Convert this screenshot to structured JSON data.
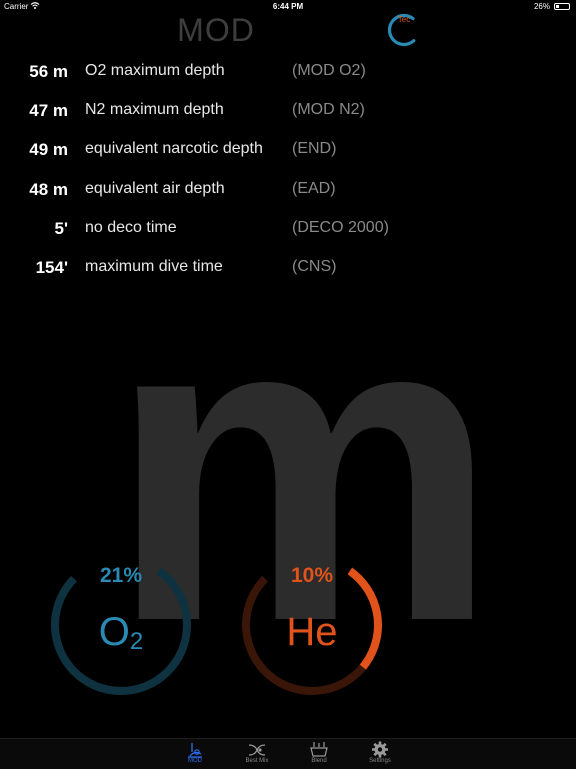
{
  "status_bar": {
    "carrier": "Carrier",
    "time": "6:44 PM",
    "battery": "26%",
    "battery_level": 0.26
  },
  "header": {
    "title": "MOD",
    "tec_label": "Tec",
    "tec_color": "#2a8ab3"
  },
  "rows": [
    {
      "value": "56 m",
      "label": "O2 maximum depth",
      "abbr": "(MOD O2)"
    },
    {
      "value": "47 m",
      "label": "N2 maximum depth",
      "abbr": "(MOD N2)"
    },
    {
      "value": "49 m",
      "label": "equivalent narcotic depth",
      "abbr": "(END)"
    },
    {
      "value": "48 m",
      "label": "equivalent air depth",
      "abbr": "(EAD)"
    },
    {
      "value": "5'",
      "label": "no deco time",
      "abbr": "(DECO 2000)"
    },
    {
      "value": "154'",
      "label": "maximum dive time",
      "abbr": "(CNS)"
    }
  ],
  "background_letter": "m",
  "gauges": {
    "o2": {
      "percent": "21%",
      "fraction": 0.21,
      "gas": "O",
      "sub": "2",
      "color": "#2a8ab3",
      "track": "#0f3240"
    },
    "he": {
      "percent": "10%",
      "fraction": 0.1,
      "gas": "He",
      "color": "#e2531c",
      "track": "#3a1608"
    }
  },
  "tabs": [
    {
      "label": "MOD",
      "icon": "diver-icon",
      "active": true
    },
    {
      "label": "Best Mix",
      "icon": "mix-icon",
      "active": false
    },
    {
      "label": "Blend",
      "icon": "blend-icon",
      "active": false
    },
    {
      "label": "Settings",
      "icon": "gear-icon",
      "active": false
    }
  ],
  "colors": {
    "accent": "#2d6cf0",
    "o2": "#2a8ab3",
    "he": "#e2531c"
  }
}
